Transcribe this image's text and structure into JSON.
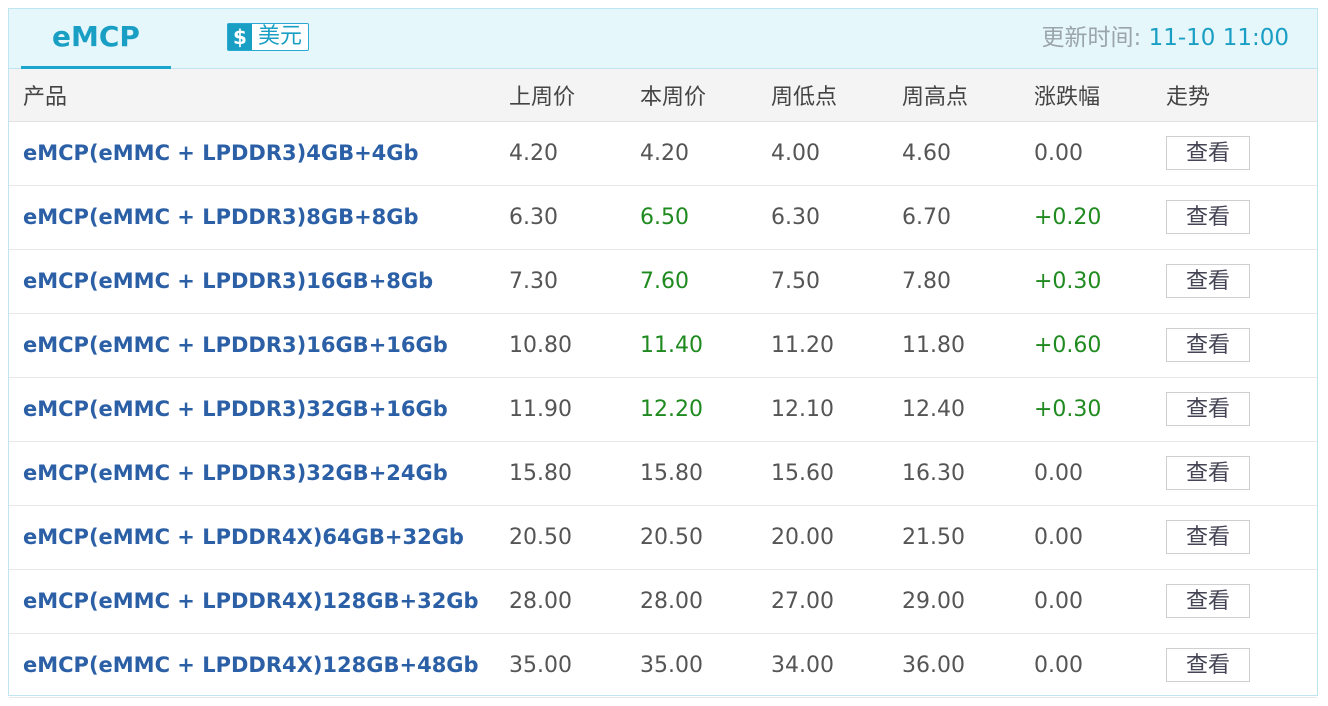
{
  "header": {
    "tab_label": "eMCP",
    "currency_symbol": "$",
    "currency_label": "美元",
    "update_label": "更新时间: ",
    "update_value": "11-10 11:00"
  },
  "table": {
    "columns": [
      "产品",
      "上周价",
      "本周价",
      "周低点",
      "周高点",
      "涨跌幅",
      "走势"
    ],
    "view_label": "查看",
    "colors": {
      "up": "#1f8a1f",
      "product": "#2b5fa6",
      "accent": "#1a9fc4"
    },
    "rows": [
      {
        "product": "eMCP(eMMC + LPDDR3)4GB+4Gb",
        "last_week": "4.20",
        "this_week": "4.20",
        "low": "4.00",
        "high": "4.60",
        "change": "0.00",
        "up": false
      },
      {
        "product": "eMCP(eMMC + LPDDR3)8GB+8Gb",
        "last_week": "6.30",
        "this_week": "6.50",
        "low": "6.30",
        "high": "6.70",
        "change": "+0.20",
        "up": true
      },
      {
        "product": "eMCP(eMMC + LPDDR3)16GB+8Gb",
        "last_week": "7.30",
        "this_week": "7.60",
        "low": "7.50",
        "high": "7.80",
        "change": "+0.30",
        "up": true
      },
      {
        "product": "eMCP(eMMC + LPDDR3)16GB+16Gb",
        "last_week": "10.80",
        "this_week": "11.40",
        "low": "11.20",
        "high": "11.80",
        "change": "+0.60",
        "up": true
      },
      {
        "product": "eMCP(eMMC + LPDDR3)32GB+16Gb",
        "last_week": "11.90",
        "this_week": "12.20",
        "low": "12.10",
        "high": "12.40",
        "change": "+0.30",
        "up": true
      },
      {
        "product": "eMCP(eMMC + LPDDR3)32GB+24Gb",
        "last_week": "15.80",
        "this_week": "15.80",
        "low": "15.60",
        "high": "16.30",
        "change": "0.00",
        "up": false
      },
      {
        "product": "eMCP(eMMC + LPDDR4X)64GB+32Gb",
        "last_week": "20.50",
        "this_week": "20.50",
        "low": "20.00",
        "high": "21.50",
        "change": "0.00",
        "up": false
      },
      {
        "product": "eMCP(eMMC + LPDDR4X)128GB+32Gb",
        "last_week": "28.00",
        "this_week": "28.00",
        "low": "27.00",
        "high": "29.00",
        "change": "0.00",
        "up": false
      },
      {
        "product": "eMCP(eMMC + LPDDR4X)128GB+48Gb",
        "last_week": "35.00",
        "this_week": "35.00",
        "low": "34.00",
        "high": "36.00",
        "change": "0.00",
        "up": false
      }
    ]
  }
}
